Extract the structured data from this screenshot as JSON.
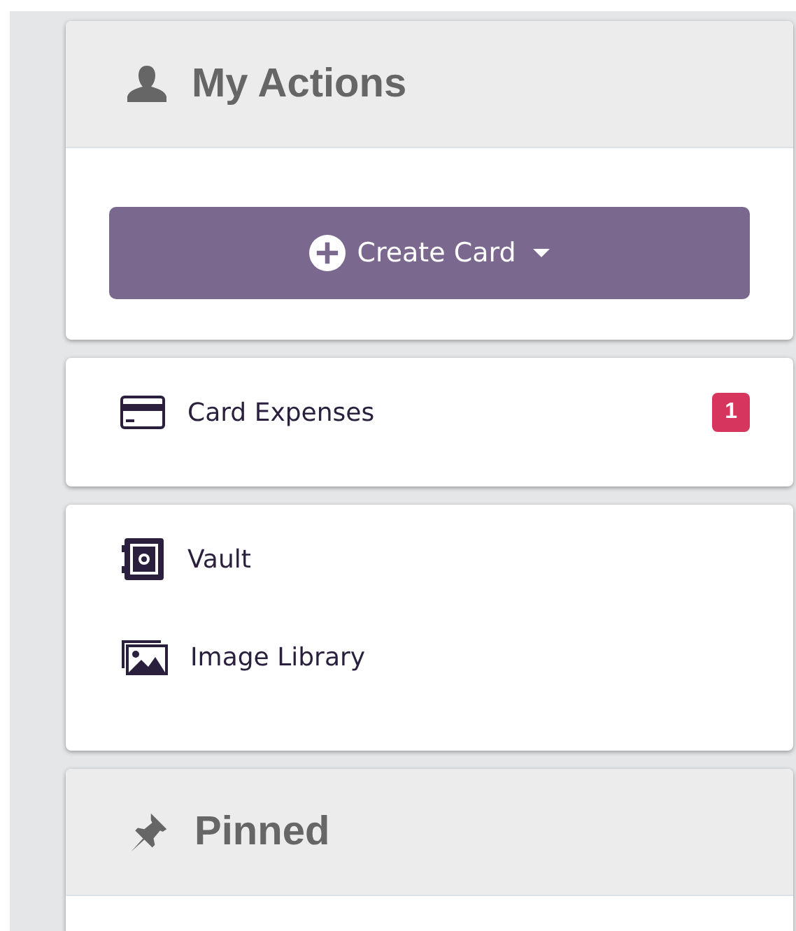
{
  "panels": [
    {
      "kind": "actions",
      "title": "My Actions",
      "button": {
        "label": "Create Card"
      }
    },
    {
      "kind": "list",
      "items": [
        {
          "kind": "card",
          "label": "Card Expenses",
          "badge": "1"
        }
      ]
    },
    {
      "kind": "list",
      "items": [
        {
          "kind": "vault",
          "label": "Vault"
        },
        {
          "kind": "image",
          "label": "Image Library"
        }
      ]
    },
    {
      "kind": "pinned",
      "title": "Pinned"
    }
  ]
}
